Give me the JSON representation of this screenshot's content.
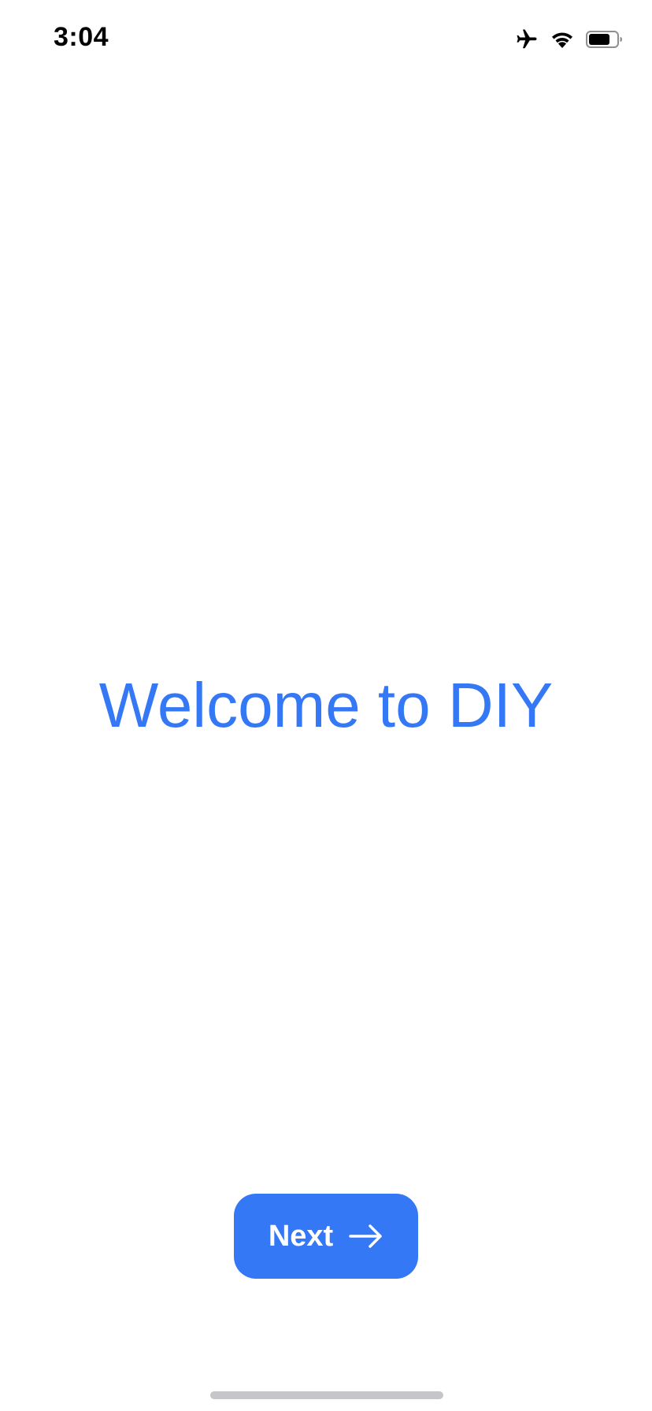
{
  "status_bar": {
    "time": "3:04",
    "icons": [
      "airplane-icon",
      "wifi-icon",
      "battery-icon"
    ]
  },
  "welcome": {
    "title": "Welcome to DIY"
  },
  "next_button": {
    "label": "Next",
    "icon": "arrow-right-icon"
  },
  "colors": {
    "accent": "#3478f6",
    "background": "#ffffff",
    "home_indicator": "#c6c6c8"
  }
}
